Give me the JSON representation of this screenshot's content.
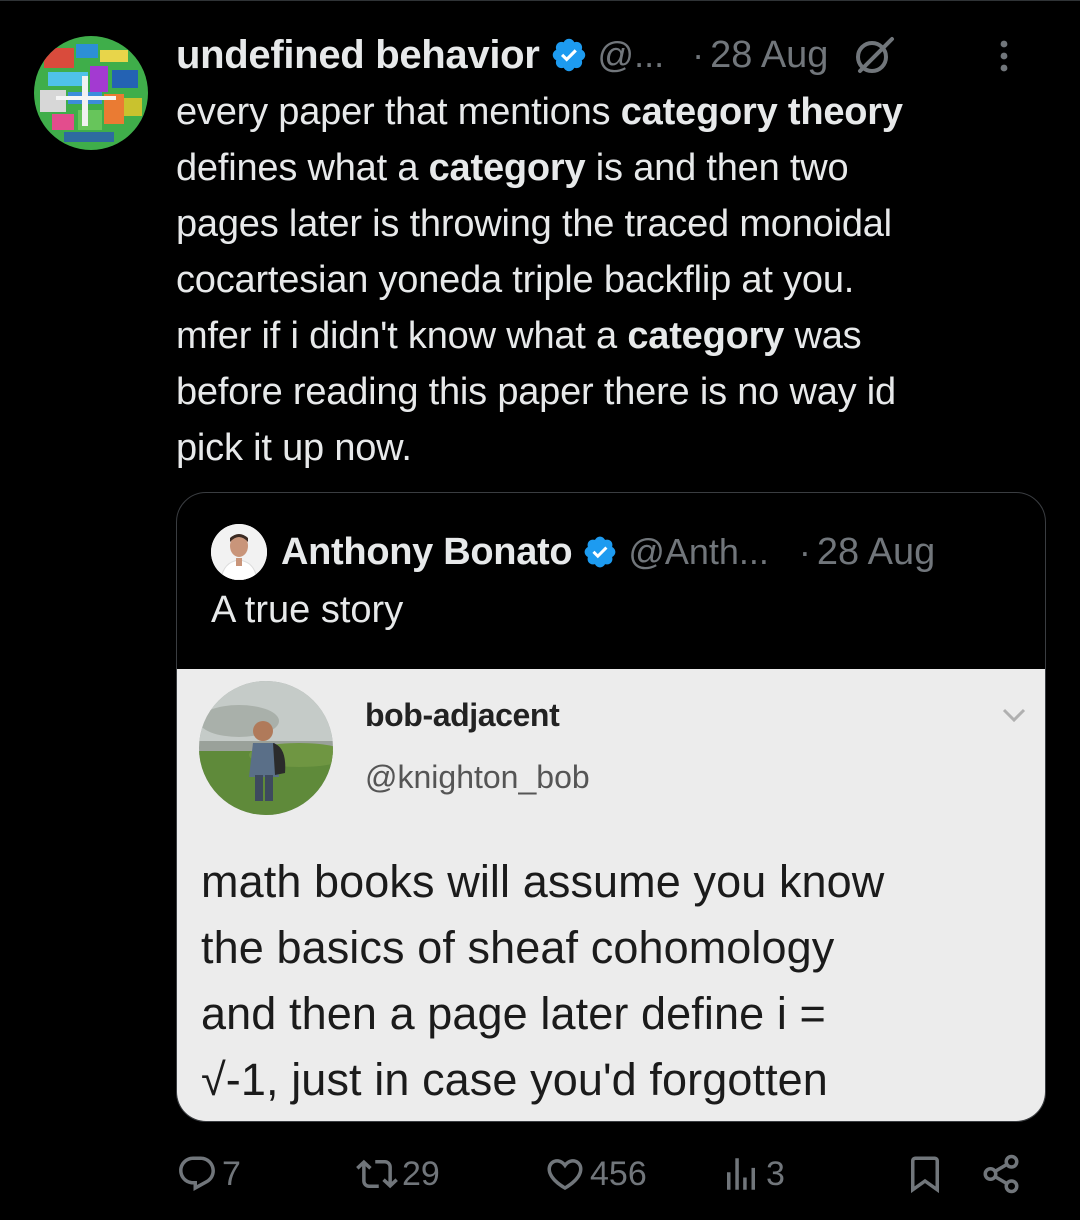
{
  "tweet": {
    "display_name": "undefined behavior",
    "handle": "@...",
    "separator": "·",
    "date": "28 Aug",
    "text_lines": [
      [
        {
          "t": "every paper that mentions ",
          "b": false
        },
        {
          "t": "category theory",
          "b": true
        }
      ],
      [
        {
          "t": "defines what a ",
          "b": false
        },
        {
          "t": "category",
          "b": true
        },
        {
          "t": " is and then two",
          "b": false
        }
      ],
      [
        {
          "t": "pages later is throwing the traced monoidal",
          "b": false
        }
      ],
      [
        {
          "t": "cocartesian yoneda triple backflip at you.",
          "b": false
        }
      ],
      [
        {
          "t": "mfer if i didn't know what a ",
          "b": false
        },
        {
          "t": "category",
          "b": true
        },
        {
          "t": " was",
          "b": false
        }
      ],
      [
        {
          "t": "before reading this paper there is no way id",
          "b": false
        }
      ],
      [
        {
          "t": "pick it up now.",
          "b": false
        }
      ]
    ]
  },
  "quote": {
    "display_name": "Anthony Bonato",
    "handle": "@Anth...",
    "separator": "·",
    "date": "28 Aug",
    "text": "A true story",
    "image": {
      "name": "bob-adjacent",
      "handle": "@knighton_bob",
      "text_lines": [
        "math books will assume you know",
        "the basics of sheaf cohomology",
        "and then a page later define i =",
        "√-1, just in case you'd forgotten"
      ]
    }
  },
  "actions": {
    "replies": "7",
    "retweets": "29",
    "likes": "456",
    "views": "3"
  },
  "colors": {
    "background": "#000000",
    "text": "#e7e9ea",
    "muted": "#71767b",
    "verified": "#1d9bf0",
    "border": "#2f3336"
  },
  "icons": [
    "avatar",
    "verified-badge-icon",
    "grok-icon",
    "more-icon",
    "reply-icon",
    "retweet-icon",
    "like-icon",
    "views-icon",
    "bookmark-icon",
    "share-icon",
    "chevron-down-icon"
  ]
}
